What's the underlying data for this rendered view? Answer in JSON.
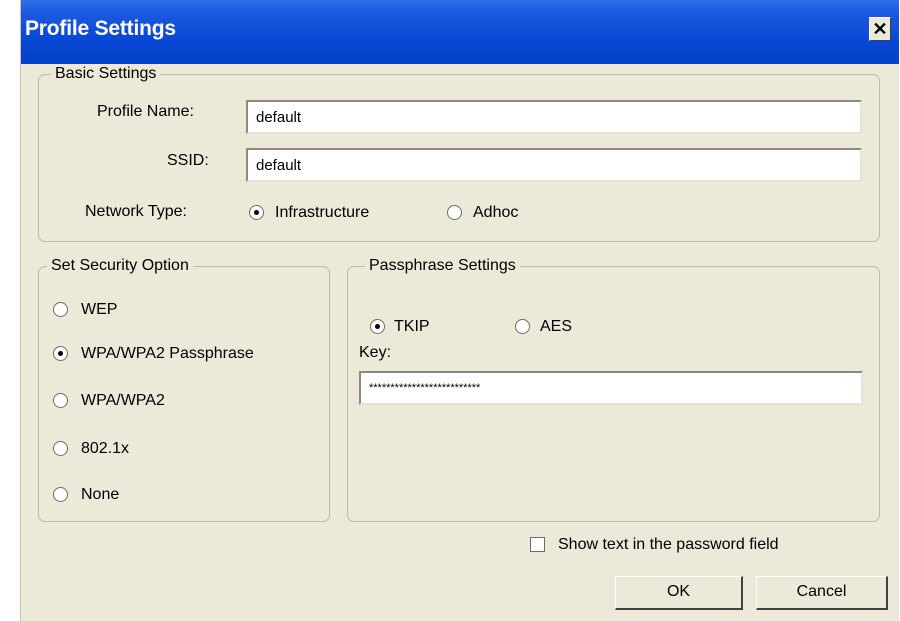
{
  "window": {
    "title": "Profile Settings",
    "close_symbol": "✕"
  },
  "basic": {
    "legend": "Basic Settings",
    "profile_name_label": "Profile Name:",
    "profile_name_value": "default",
    "ssid_label": "SSID:",
    "ssid_value": "default",
    "network_type_label": "Network Type:",
    "infrastructure_label": "Infrastructure",
    "adhoc_label": "Adhoc",
    "network_type_selected": "Infrastructure"
  },
  "security": {
    "legend": "Set Security Option",
    "options": [
      "WEP",
      "WPA/WPA2 Passphrase",
      "WPA/WPA2",
      "802.1x",
      "None"
    ],
    "selected": "WPA/WPA2 Passphrase"
  },
  "passphrase": {
    "legend": "Passphrase Settings",
    "tkip_label": "TKIP",
    "aes_label": "AES",
    "cipher_selected": "TKIP",
    "key_label": "Key:",
    "key_value": "**************************"
  },
  "show_text": {
    "label": "Show text in the password field",
    "checked": false
  },
  "buttons": {
    "ok": "OK",
    "cancel": "Cancel"
  }
}
